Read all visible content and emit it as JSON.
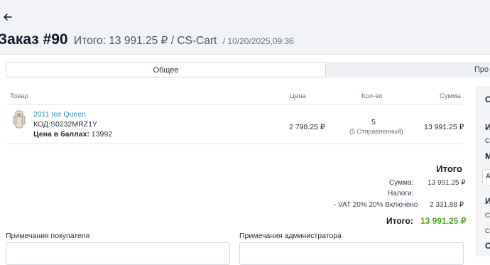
{
  "header": {
    "title": "Заказ #90",
    "subtitle": "Итого: 13 991.25 ₽ / CS-Cart",
    "datetime": "/ 10/20/2025,09:36"
  },
  "tabs": [
    {
      "label": "Общее",
      "active": true
    },
    {
      "label": "Про",
      "active": false
    }
  ],
  "table": {
    "headers": {
      "product": "Товар",
      "price": "Цена",
      "qty": "Кол-во",
      "sum": "Сумма"
    },
    "rows": [
      {
        "name": "2011 Ice Queen",
        "code": "КОД:S0232MRZ1Y",
        "points_label": "Цена в баллах:",
        "points_value": "13992",
        "price": "2 798.25 ₽",
        "qty": "5",
        "shipped": "(5 Отправленный)",
        "sum": "13 991.25 ₽"
      }
    ]
  },
  "totals": {
    "title": "Итого",
    "subtotal_label": "Сумма:",
    "subtotal_value": "13 991.25 ₽",
    "taxes_label": "Налоги:",
    "vat_label": "- VAT 20% 20% Включено",
    "vat_value": "2 331.88 ₽",
    "grand_label": "Итого:",
    "grand_value": "13 991.25 ₽"
  },
  "notes": {
    "customer_label": "Примечания покупателя",
    "admin_label": "Примечания администратора"
  },
  "sidebar": {
    "items": [
      "С",
      "И",
      "Ст",
      "М",
      "А",
      "И",
      "CS",
      "Ст",
      "О"
    ]
  },
  "colors": {
    "accent_link": "#2f8ad3",
    "grand_total": "#4caf1f",
    "header_bg": "#f1f3f6"
  }
}
